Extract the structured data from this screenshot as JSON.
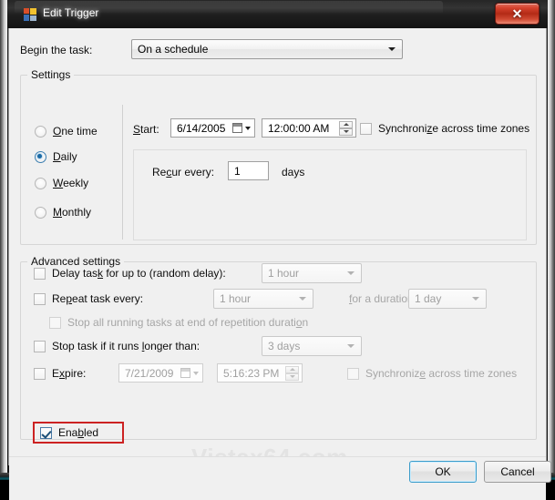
{
  "window": {
    "title": "Edit Trigger",
    "icon": "task-scheduler-icon",
    "close_glyph": "✕",
    "accent_close": "#b32a16",
    "highlight_color": "#cc2222",
    "focus_color": "#3c9cc9"
  },
  "begin": {
    "label": "Begin the task:",
    "selected": "On a schedule"
  },
  "settings": {
    "title": "Settings",
    "schedule_options": [
      {
        "label": "One time",
        "accel": "O",
        "selected": false
      },
      {
        "label": "Daily",
        "accel": "D",
        "selected": true
      },
      {
        "label": "Weekly",
        "accel": "W",
        "selected": false
      },
      {
        "label": "Monthly",
        "accel": "M",
        "selected": false
      }
    ],
    "start": {
      "label": "Start:",
      "accel": "S",
      "date": "6/14/2005",
      "time": "12:00:00 AM"
    },
    "sync_timezones": {
      "label": "Synchronize across time zones",
      "checked": false,
      "disabled": false
    },
    "recurrence": {
      "label": "Recur every:",
      "accel": "c",
      "value": "1",
      "unit": "days"
    }
  },
  "advanced": {
    "title": "Advanced settings",
    "delay_task": {
      "label": "Delay task for up to (random delay):",
      "checked": false,
      "value": "1 hour",
      "disabled": true
    },
    "repeat_task": {
      "label": "Repeat task every:",
      "checked": false,
      "value": "1 hour",
      "disabled": true,
      "duration_label": "for a duration of:",
      "duration_value": "1 day"
    },
    "stop_all_running": {
      "label": "Stop all running tasks at end of repetition duration",
      "checked": false,
      "disabled": true
    },
    "stop_if_longer": {
      "label": "Stop task if it runs longer than:",
      "checked": false,
      "value": "3 days",
      "disabled": true
    },
    "expire": {
      "label": "Expire:",
      "checked": false,
      "date": "7/21/2009",
      "time": "5:16:23 PM",
      "disabled": true,
      "sync_label": "Synchronize across time zones",
      "sync_checked": false
    },
    "enabled": {
      "label": "Enabled",
      "checked": true,
      "highlighted": true
    }
  },
  "watermark": "Vistax64.com",
  "buttons": {
    "ok": "OK",
    "cancel": "Cancel"
  }
}
